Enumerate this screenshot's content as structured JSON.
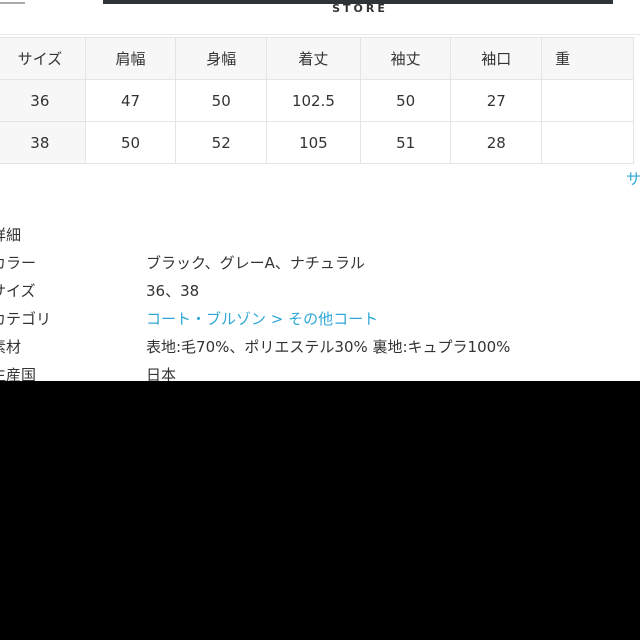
{
  "header": {
    "store_label": "STORE"
  },
  "size_table": {
    "headers": [
      "サイズ",
      "肩幅",
      "身幅",
      "着丈",
      "袖丈",
      "袖口",
      "重"
    ],
    "rows": [
      [
        "36",
        "47",
        "50",
        "102.5",
        "50",
        "27",
        ""
      ],
      [
        "38",
        "50",
        "52",
        "105",
        "51",
        "28",
        ""
      ]
    ]
  },
  "size_guide_link": "サ",
  "details": {
    "title": "詳細",
    "items": [
      {
        "label": "カラー",
        "value": "ブラック、グレーA、ナチュラル"
      },
      {
        "label": "サイズ",
        "value": "36、38"
      },
      {
        "label": "カテゴリ",
        "value": "コート・ブルゾン > その他コート",
        "link": true
      },
      {
        "label": "素材",
        "value": "表地:毛70%、ポリエステル30% 裏地:キュプラ100%"
      },
      {
        "label": "生産国",
        "value": "日本"
      }
    ]
  },
  "colors": {
    "link": "#2ea7d6",
    "topbar": "#2e3338"
  }
}
